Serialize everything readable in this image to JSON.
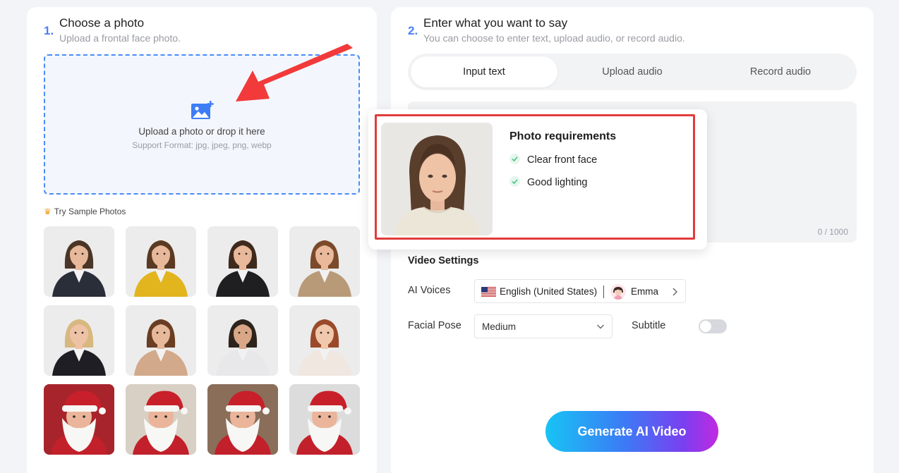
{
  "left": {
    "step_number": "1.",
    "title": "Choose a photo",
    "subtitle": "Upload a frontal face photo.",
    "dropzone": {
      "main_text": "Upload a photo or drop it here",
      "sub_text": "Support Format: jpg, jpeg, png, webp",
      "icon": "image-upload-icon"
    },
    "samples_label": "Try Sample Photos",
    "samples": [
      {
        "name": "man-in-suit",
        "bg": "#ececec",
        "skin": "#e8b89a",
        "hair": "#4a3526",
        "outfit": "#2a2e38"
      },
      {
        "name": "woman-yellow-blazer",
        "bg": "#ececec",
        "skin": "#e8b89a",
        "hair": "#5a3a22",
        "outfit": "#e2b51f"
      },
      {
        "name": "woman-black-blazer",
        "bg": "#ececec",
        "skin": "#e8b89a",
        "hair": "#3e2a1c",
        "outfit": "#1f1f22"
      },
      {
        "name": "woman-beige-blazer",
        "bg": "#ececec",
        "skin": "#eab99b",
        "hair": "#7a4a2a",
        "outfit": "#b99a78"
      },
      {
        "name": "woman-glasses-vest",
        "bg": "#ececec",
        "skin": "#eec2a6",
        "hair": "#d8b880",
        "outfit": "#1e1e24"
      },
      {
        "name": "woman-glasses-beige",
        "bg": "#ececec",
        "skin": "#e8b89a",
        "hair": "#6a3e22",
        "outfit": "#d2a98a"
      },
      {
        "name": "man-white-suit",
        "bg": "#ececec",
        "skin": "#d9a788",
        "hair": "#2e241c",
        "outfit": "#e8e8ea"
      },
      {
        "name": "woman-red-hair",
        "bg": "#ececec",
        "skin": "#f0c8ac",
        "hair": "#9a4a2a",
        "outfit": "#efe7e0"
      },
      {
        "name": "santa-1",
        "bg": "#a8242c",
        "skin": "#eab59a",
        "hair": "#ffffff",
        "outfit": "#c2202a"
      },
      {
        "name": "santa-2",
        "bg": "#d8cfc5",
        "skin": "#eab59a",
        "hair": "#ffffff",
        "outfit": "#c2202a"
      },
      {
        "name": "santa-3",
        "bg": "#8a6e5a",
        "skin": "#eab59a",
        "hair": "#ffffff",
        "outfit": "#c2202a"
      },
      {
        "name": "santa-4",
        "bg": "#dcdcdc",
        "skin": "#eab59a",
        "hair": "#ffffff",
        "outfit": "#c2202a"
      }
    ]
  },
  "right": {
    "step_number": "2.",
    "title": "Enter what you want to say",
    "subtitle": "You can choose to enter text, upload audio, or record audio.",
    "tabs": [
      {
        "label": "Input text",
        "active": true
      },
      {
        "label": "Upload audio",
        "active": false
      },
      {
        "label": "Record audio",
        "active": false
      }
    ],
    "counter": "0 / 1000",
    "settings_title": "Video Settings",
    "voices_label": "AI Voices",
    "voice_language": "English (United States)",
    "voice_name": "Emma",
    "pose_label": "Facial Pose",
    "pose_value": "Medium",
    "subtitle_label": "Subtitle",
    "subtitle_enabled": false,
    "generate_label": "Generate AI Video"
  },
  "popup": {
    "title": "Photo requirements",
    "requirements": [
      "Clear front face",
      "Good lighting"
    ]
  },
  "colors": {
    "accent": "#4a7ef7",
    "highlight": "#e23b3b",
    "check": "#3fbf7f"
  }
}
